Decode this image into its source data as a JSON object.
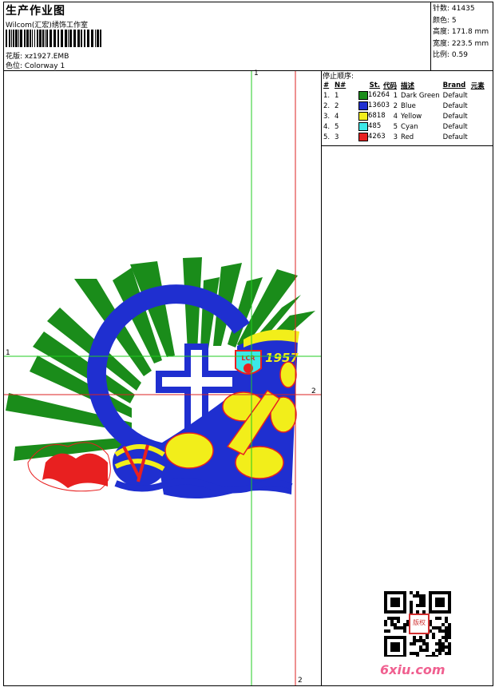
{
  "header": {
    "title": "生产作业图",
    "company": "Wilcom(汇宏)绣饰工作室",
    "pattern_label": "花版:",
    "pattern_value": "xz1927.EMB",
    "colorway_label": "色位:",
    "colorway_value": "Colorway 1"
  },
  "stats": {
    "stitches_label": "针数:",
    "stitches_value": "41435",
    "colors_label": "颜色:",
    "colors_value": "5",
    "height_label": "高度:",
    "height_value": "171.8 mm",
    "width_label": "宽度:",
    "width_value": "223.5 mm",
    "scale_label": "比例:",
    "scale_value": "0.59"
  },
  "stop_sequence": {
    "title": "停止顺序:",
    "columns": [
      "#",
      "N#",
      "St.",
      "代码",
      "描述",
      "Brand",
      "元素"
    ],
    "rows": [
      {
        "seq": "1.",
        "n": "1",
        "color": "#1a8c1a",
        "st": "16264",
        "code": "1",
        "desc": "Dark Green",
        "brand": "Default"
      },
      {
        "seq": "2.",
        "n": "2",
        "color": "#1f2fd0",
        "st": "13603",
        "code": "2",
        "desc": "Blue",
        "brand": "Default"
      },
      {
        "seq": "3.",
        "n": "4",
        "color": "#f2ee1a",
        "st": "6818",
        "code": "4",
        "desc": "Yellow",
        "brand": "Default"
      },
      {
        "seq": "4.",
        "n": "5",
        "color": "#3ce8e8",
        "st": "485",
        "code": "5",
        "desc": "Cyan",
        "brand": "Default"
      },
      {
        "seq": "5.",
        "n": "3",
        "color": "#e82020",
        "st": "4263",
        "code": "3",
        "desc": "Red",
        "brand": "Default"
      }
    ]
  },
  "guides": {
    "v1_top": "1",
    "v2_bottom": "2",
    "h1_left": "1",
    "h2_right": "2"
  },
  "design": {
    "emblem_text": "LCR",
    "year": "1957",
    "colors": {
      "green": "#1a8c1a",
      "blue": "#1f2fd0",
      "yellow": "#f2ee1a",
      "red": "#e82020",
      "cyan": "#3ce8e8"
    }
  },
  "watermark": {
    "qr_badge": "版权",
    "site": "6xiu.com"
  }
}
